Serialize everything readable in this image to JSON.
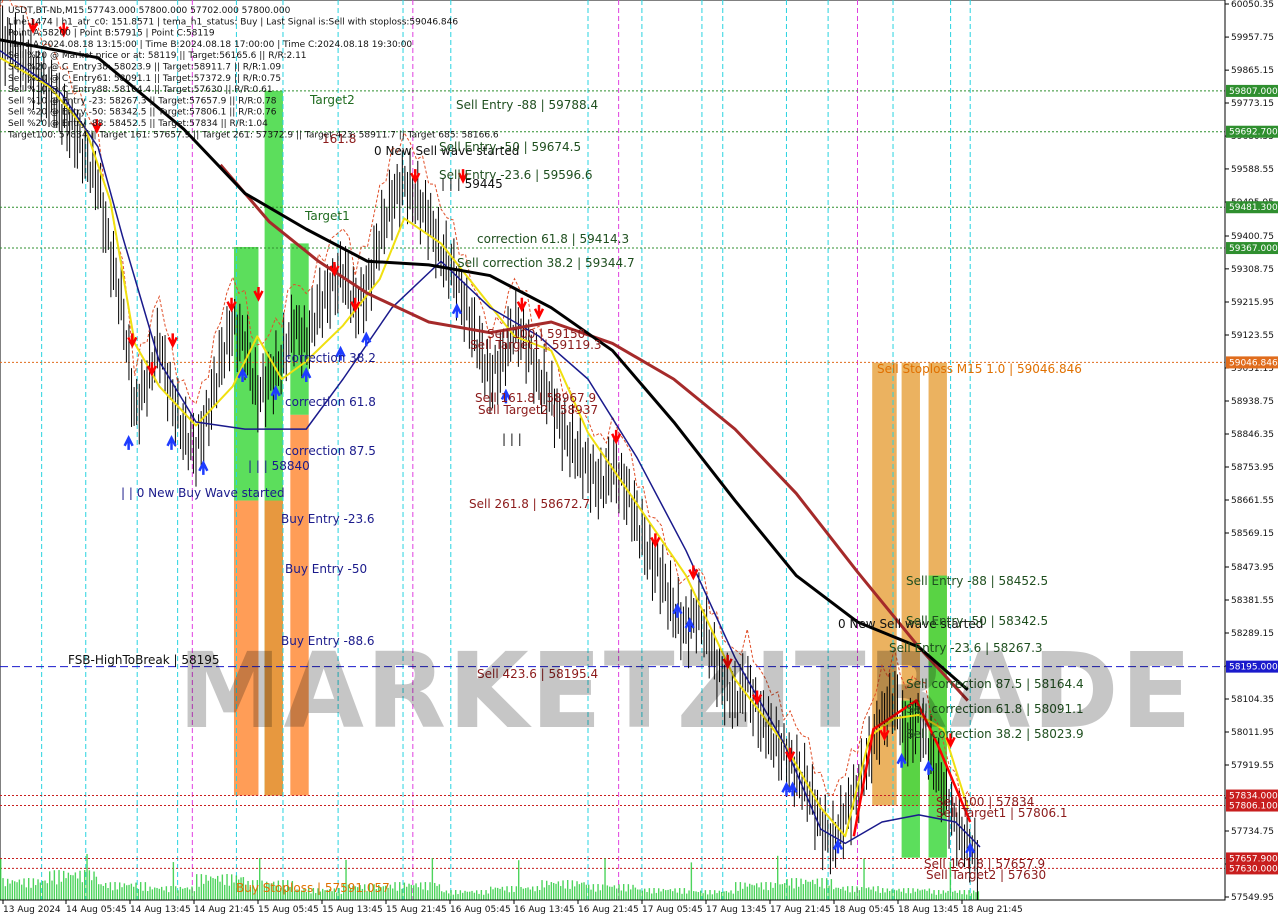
{
  "info_lines": [
    "USDT,BT-Nb,M15  57743.000 57800.000 57702.000 57800.000",
    "Line:1474 | h1_atr_c0: 151.8571 | tema_h1_status: Buy | Last Signal is:Sell with stoploss:59046.846",
    "Point A:58200 | Point B:57915 | Point C:58119",
    "Time A:2024.08.18 13:15:00 | Time B:2024.08.18 17:00:00 | Time C:2024.08.18 19:30:00",
    "Sell %20 @ Market price or at: 58119 || Target:56165.6 || R/R:2.11",
    "Sell %20 @ C_Entry38: 58023.9 || Target:58911.7 || R/R:1.09",
    "Sell %10 @ C_Entry61: 58091.1 || Target:57372.9 || R/R:0.75",
    "Sell %10 @ C_Entry88: 58164.4 || Target:57630 || R/R:0.61",
    "Sell %10 @ Entry -23: 58267.3 || Target:57657.9 || R/R:0.78",
    "Sell %20 @ Entry -50: 58342.5 || Target:57806.1 || R/R:0.76",
    "Sell %20 @ Entry -88: 58452.5 || Target:57834 || R/R:1.04",
    "Target100: 57834 || Target 161: 57657.9 || Target 261: 57372.9 || Target 423: 58911.7 || Target 685: 58166.6"
  ],
  "annotations": [
    {
      "text": "Target2",
      "color": "#1f6b1f"
    },
    {
      "text": "Target1",
      "color": "#1f6b1f"
    },
    {
      "text": "161.8",
      "color": "#8b1a1a"
    },
    {
      "text": "0 New Sell wave started",
      "color": "#111111"
    },
    {
      "text": "Sell Entry -88 | 59788.4",
      "color": "#1f4f1f"
    },
    {
      "text": "Sell Entry -50 | 59674.5",
      "color": "#1f4f1f"
    },
    {
      "text": "Sell Entry -23.6 | 59596.6",
      "color": "#1f4f1f"
    },
    {
      "text": "| | | 59445",
      "color": "#111111"
    },
    {
      "text": "correction 61.8 | 59414.3",
      "color": "#1f4f1f"
    },
    {
      "text": "Sell correction 38.2 | 59344.7",
      "color": "#1f4f1f"
    },
    {
      "text": "Sell 100 | 59150",
      "color": "#8b1a1a"
    },
    {
      "text": "Sell Target1 | 59119.3",
      "color": "#8b1a1a"
    },
    {
      "text": "Sell 161.8 | 58967.9",
      "color": "#8b1a1a"
    },
    {
      "text": "Sell Target2 | 58937",
      "color": "#8b1a1a"
    },
    {
      "text": "| | |",
      "color": "#111111"
    },
    {
      "text": "Sell  261.8 | 58672.7",
      "color": "#8b1a1a"
    },
    {
      "text": "Sell  423.6 | 58195.4",
      "color": "#8b1a1a"
    },
    {
      "text": "correction 38.2",
      "color": "#1a1a8b"
    },
    {
      "text": "correction 61.8",
      "color": "#1a1a8b"
    },
    {
      "text": "correction 87.5",
      "color": "#1a1a8b"
    },
    {
      "text": "| | | 58840",
      "color": "#1a1a8b"
    },
    {
      "text": "| | 0 New Buy Wave started",
      "color": "#1a1a8b"
    },
    {
      "text": "Buy Entry -23.6",
      "color": "#1a1a8b"
    },
    {
      "text": "Buy Entry -50",
      "color": "#1a1a8b"
    },
    {
      "text": "Buy Entry -88.6",
      "color": "#1a1a8b"
    },
    {
      "text": "Buy Stoploss | 57591.057",
      "color": "#e07000"
    },
    {
      "text": "Sell Stoploss M15 1.0 | 59046.846",
      "color": "#e07000"
    },
    {
      "text": "FSB-HighToBreak | 58195",
      "color": "#111111"
    },
    {
      "text": "Sell Entry -88 | 58452.5",
      "color": "#1f4f1f"
    },
    {
      "text": "0 New Sell wave started",
      "color": "#111111"
    },
    {
      "text": "Sell Entry -50 | 58342.5",
      "color": "#1f4f1f"
    },
    {
      "text": "Sell Entry -23.6 | 58267.3",
      "color": "#1f4f1f"
    },
    {
      "text": "Sell correction 87.5 | 58164.4",
      "color": "#1f4f1f"
    },
    {
      "text": "Sell correction 61.8 | 58091.1",
      "color": "#1f4f1f"
    },
    {
      "text": "Sell correction 38.2 | 58023.9",
      "color": "#1f4f1f"
    },
    {
      "text": "Sell 100 | 57834",
      "color": "#8b1a1a"
    },
    {
      "text": "Sell Target1 | 57806.1",
      "color": "#8b1a1a"
    },
    {
      "text": "Sell 161.8 | 57657.9",
      "color": "#8b1a1a"
    },
    {
      "text": "Sell Target2 | 57630",
      "color": "#8b1a1a"
    }
  ],
  "watermark_text": "MARKETZITRADE",
  "chart_data": {
    "type": "candlestick",
    "symbol": "USDT,BT-Nb",
    "timeframe": "M15",
    "ylim": [
      57549.95,
      60050.35
    ],
    "y_ticks": [
      60050.35,
      59957.75,
      59865.15,
      59773.15,
      59680.55,
      59588.55,
      59495.95,
      59400.75,
      59308.75,
      59215.95,
      59123.55,
      59031.15,
      58938.75,
      58846.35,
      58753.95,
      58661.55,
      58569.15,
      58473.95,
      58381.55,
      58289.15,
      58196.75,
      58104.35,
      58011.95,
      57919.55,
      57827.15,
      57734.75,
      57642.35,
      57549.95
    ],
    "x_labels": [
      "13 Aug 2024",
      "14 Aug 05:45",
      "14 Aug 13:45",
      "14 Aug 21:45",
      "15 Aug 05:45",
      "15 Aug 13:45",
      "15 Aug 21:45",
      "16 Aug 05:45",
      "16 Aug 13:45",
      "16 Aug 21:45",
      "17 Aug 05:45",
      "17 Aug 13:45",
      "17 Aug 21:45",
      "18 Aug 05:45",
      "18 Aug 13:45",
      "18 Aug 21:45"
    ],
    "price_levels": [
      {
        "value": 59807.0,
        "label": "59807.000",
        "color": "#2f8f2f",
        "style": "dotted"
      },
      {
        "value": 59692.7,
        "label": "59692.700",
        "color": "#2f8f2f",
        "style": "dotted"
      },
      {
        "value": 59481.3,
        "label": "59481.300",
        "color": "#2f8f2f",
        "style": "dotted"
      },
      {
        "value": 59367.0,
        "label": "59367.000",
        "color": "#2f8f2f",
        "style": "dotted"
      },
      {
        "value": 59046.846,
        "label": "59046.846",
        "color": "#e06c1c",
        "style": "dotted"
      },
      {
        "value": 58195.0,
        "label": "58195.000",
        "color": "#1a1acc",
        "style": "dashed"
      },
      {
        "value": 57834.0,
        "label": "57834.000",
        "color": "#c81e1e",
        "style": "dotted"
      },
      {
        "value": 57806.1,
        "label": "57806.100",
        "color": "#c81e1e",
        "style": "dotted"
      },
      {
        "value": 57657.9,
        "label": "57657.900",
        "color": "#c81e1e",
        "style": "dotted"
      },
      {
        "value": 57630.0,
        "label": "57630.000",
        "color": "#c81e1e",
        "style": "dotted"
      }
    ],
    "zones": [
      {
        "x_frac": [
          0.191,
          0.211
        ],
        "price": [
          58660,
          59370
        ],
        "color": "#3fd83f"
      },
      {
        "x_frac": [
          0.191,
          0.211
        ],
        "price": [
          57834,
          58660
        ],
        "color": "#ff8c3a"
      },
      {
        "x_frac": [
          0.216,
          0.231
        ],
        "price": [
          57834,
          59807
        ],
        "color": "#3fd83f"
      },
      {
        "x_frac": [
          0.216,
          0.231
        ],
        "price": [
          57834,
          58660
        ],
        "color": "#ff8c3a"
      },
      {
        "x_frac": [
          0.237,
          0.252
        ],
        "price": [
          58900,
          59380
        ],
        "color": "#3fd83f"
      },
      {
        "x_frac": [
          0.237,
          0.252
        ],
        "price": [
          57834,
          58900
        ],
        "color": "#ff8c3a"
      },
      {
        "x_frac": [
          0.712,
          0.732
        ],
        "price": [
          57806,
          59046
        ],
        "color": "#e8a444"
      },
      {
        "x_frac": [
          0.736,
          0.751
        ],
        "price": [
          57806,
          59046
        ],
        "color": "#e8a444"
      },
      {
        "x_frac": [
          0.736,
          0.751
        ],
        "price": [
          57660,
          58100
        ],
        "color": "#3fd83f"
      },
      {
        "x_frac": [
          0.758,
          0.773
        ],
        "price": [
          57806,
          59046
        ],
        "color": "#e8a444"
      },
      {
        "x_frac": [
          0.758,
          0.773
        ],
        "price": [
          57660,
          58450
        ],
        "color": "#3fd83f"
      }
    ],
    "vlines_cyan_frac": [
      0.034,
      0.07,
      0.112,
      0.145,
      0.193,
      0.231,
      0.276,
      0.329,
      0.368,
      0.48,
      0.524,
      0.573,
      0.59,
      0.642,
      0.676,
      0.729,
      0.776,
      0.792
    ],
    "vlines_magenta_frac": [
      0.157,
      0.337,
      0.505,
      0.7
    ],
    "close_path": [
      [
        0.0,
        59950
      ],
      [
        0.02,
        59900
      ],
      [
        0.04,
        59800
      ],
      [
        0.06,
        59700
      ],
      [
        0.08,
        59550
      ],
      [
        0.09,
        59350
      ],
      [
        0.1,
        59200
      ],
      [
        0.11,
        58900
      ],
      [
        0.12,
        59000
      ],
      [
        0.13,
        59100
      ],
      [
        0.14,
        58950
      ],
      [
        0.15,
        58850
      ],
      [
        0.16,
        58800
      ],
      [
        0.17,
        58900
      ],
      [
        0.18,
        59050
      ],
      [
        0.19,
        59150
      ],
      [
        0.2,
        59100
      ],
      [
        0.21,
        58950
      ],
      [
        0.22,
        59000
      ],
      [
        0.23,
        59050
      ],
      [
        0.24,
        59150
      ],
      [
        0.25,
        59100
      ],
      [
        0.26,
        59200
      ],
      [
        0.27,
        59250
      ],
      [
        0.28,
        59300
      ],
      [
        0.29,
        59200
      ],
      [
        0.3,
        59250
      ],
      [
        0.31,
        59400
      ],
      [
        0.32,
        59500
      ],
      [
        0.33,
        59550
      ],
      [
        0.34,
        59500
      ],
      [
        0.35,
        59450
      ],
      [
        0.36,
        59350
      ],
      [
        0.37,
        59300
      ],
      [
        0.38,
        59200
      ],
      [
        0.39,
        59100
      ],
      [
        0.4,
        59000
      ],
      [
        0.41,
        59050
      ],
      [
        0.42,
        59150
      ],
      [
        0.43,
        59100
      ],
      [
        0.44,
        59000
      ],
      [
        0.45,
        58950
      ],
      [
        0.46,
        58850
      ],
      [
        0.47,
        58800
      ],
      [
        0.48,
        58750
      ],
      [
        0.49,
        58700
      ],
      [
        0.5,
        58750
      ],
      [
        0.51,
        58700
      ],
      [
        0.52,
        58600
      ],
      [
        0.53,
        58500
      ],
      [
        0.54,
        58450
      ],
      [
        0.55,
        58350
      ],
      [
        0.56,
        58300
      ],
      [
        0.57,
        58350
      ],
      [
        0.58,
        58250
      ],
      [
        0.59,
        58150
      ],
      [
        0.6,
        58100
      ],
      [
        0.61,
        58150
      ],
      [
        0.62,
        58050
      ],
      [
        0.63,
        58000
      ],
      [
        0.64,
        57950
      ],
      [
        0.65,
        57900
      ],
      [
        0.66,
        57850
      ],
      [
        0.67,
        57750
      ],
      [
        0.68,
        57700
      ],
      [
        0.69,
        57780
      ],
      [
        0.7,
        57850
      ],
      [
        0.71,
        57950
      ],
      [
        0.72,
        58050
      ],
      [
        0.73,
        58100
      ],
      [
        0.74,
        58000
      ],
      [
        0.75,
        58050
      ],
      [
        0.76,
        57950
      ],
      [
        0.77,
        57850
      ],
      [
        0.78,
        57750
      ],
      [
        0.79,
        57700
      ],
      [
        0.8,
        57650
      ]
    ],
    "ma_black": [
      [
        0.0,
        59950
      ],
      [
        0.08,
        59900
      ],
      [
        0.15,
        59700
      ],
      [
        0.2,
        59520
      ],
      [
        0.25,
        59420
      ],
      [
        0.3,
        59330
      ],
      [
        0.35,
        59320
      ],
      [
        0.4,
        59290
      ],
      [
        0.45,
        59200
      ],
      [
        0.5,
        59080
      ],
      [
        0.55,
        58880
      ],
      [
        0.6,
        58660
      ],
      [
        0.65,
        58450
      ],
      [
        0.7,
        58320
      ],
      [
        0.75,
        58250
      ],
      [
        0.79,
        58130
      ]
    ],
    "ma_darkred": [
      [
        0.18,
        59600
      ],
      [
        0.22,
        59440
      ],
      [
        0.26,
        59330
      ],
      [
        0.3,
        59240
      ],
      [
        0.35,
        59160
      ],
      [
        0.4,
        59130
      ],
      [
        0.45,
        59160
      ],
      [
        0.5,
        59100
      ],
      [
        0.55,
        59000
      ],
      [
        0.6,
        58860
      ],
      [
        0.65,
        58680
      ],
      [
        0.7,
        58460
      ],
      [
        0.75,
        58250
      ],
      [
        0.79,
        58100
      ]
    ],
    "ma_navy": [
      [
        0.0,
        59920
      ],
      [
        0.05,
        59800
      ],
      [
        0.08,
        59650
      ],
      [
        0.1,
        59400
      ],
      [
        0.13,
        59050
      ],
      [
        0.16,
        58880
      ],
      [
        0.2,
        58860
      ],
      [
        0.25,
        58860
      ],
      [
        0.28,
        59000
      ],
      [
        0.32,
        59200
      ],
      [
        0.36,
        59330
      ],
      [
        0.4,
        59200
      ],
      [
        0.44,
        59120
      ],
      [
        0.48,
        59000
      ],
      [
        0.52,
        58780
      ],
      [
        0.56,
        58520
      ],
      [
        0.6,
        58220
      ],
      [
        0.64,
        57980
      ],
      [
        0.67,
        57740
      ],
      [
        0.69,
        57700
      ],
      [
        0.72,
        57760
      ],
      [
        0.75,
        57780
      ],
      [
        0.78,
        57760
      ],
      [
        0.8,
        57690
      ]
    ],
    "ma_yellow": [
      [
        0.0,
        59900
      ],
      [
        0.04,
        59820
      ],
      [
        0.07,
        59700
      ],
      [
        0.09,
        59500
      ],
      [
        0.11,
        59100
      ],
      [
        0.13,
        58980
      ],
      [
        0.16,
        58870
      ],
      [
        0.19,
        58980
      ],
      [
        0.21,
        59120
      ],
      [
        0.23,
        59000
      ],
      [
        0.25,
        59050
      ],
      [
        0.28,
        59150
      ],
      [
        0.31,
        59280
      ],
      [
        0.33,
        59450
      ],
      [
        0.36,
        59380
      ],
      [
        0.39,
        59250
      ],
      [
        0.42,
        59120
      ],
      [
        0.45,
        59080
      ],
      [
        0.48,
        58850
      ],
      [
        0.52,
        58650
      ],
      [
        0.56,
        58450
      ],
      [
        0.6,
        58160
      ],
      [
        0.64,
        57980
      ],
      [
        0.67,
        57800
      ],
      [
        0.69,
        57720
      ],
      [
        0.71,
        58000
      ],
      [
        0.73,
        58050
      ],
      [
        0.75,
        58060
      ],
      [
        0.77,
        58020
      ],
      [
        0.79,
        57800
      ]
    ],
    "red_leg": [
      [
        0.697,
        57720
      ],
      [
        0.713,
        58020
      ],
      [
        0.748,
        58100
      ],
      [
        0.765,
        57980
      ],
      [
        0.792,
        57760
      ]
    ],
    "up_arrows_frac": [
      [
        0.105,
        58830
      ],
      [
        0.14,
        58830
      ],
      [
        0.166,
        58760
      ],
      [
        0.198,
        59020
      ],
      [
        0.225,
        58970
      ],
      [
        0.25,
        59020
      ],
      [
        0.278,
        59080
      ],
      [
        0.299,
        59120
      ],
      [
        0.373,
        59200
      ],
      [
        0.413,
        58960
      ],
      [
        0.553,
        58360
      ],
      [
        0.563,
        58320
      ],
      [
        0.642,
        57860
      ],
      [
        0.647,
        57860
      ],
      [
        0.684,
        57700
      ],
      [
        0.736,
        57940
      ],
      [
        0.758,
        57920
      ],
      [
        0.792,
        57690
      ]
    ],
    "down_arrows_frac": [
      [
        0.027,
        59980
      ],
      [
        0.052,
        59970
      ],
      [
        0.079,
        59700
      ],
      [
        0.108,
        59100
      ],
      [
        0.124,
        59020
      ],
      [
        0.141,
        59100
      ],
      [
        0.189,
        59200
      ],
      [
        0.211,
        59230
      ],
      [
        0.273,
        59300
      ],
      [
        0.29,
        59200
      ],
      [
        0.339,
        59560
      ],
      [
        0.378,
        59560
      ],
      [
        0.426,
        59200
      ],
      [
        0.44,
        59180
      ],
      [
        0.503,
        58830
      ],
      [
        0.535,
        58540
      ],
      [
        0.566,
        58450
      ],
      [
        0.594,
        58200
      ],
      [
        0.618,
        58100
      ],
      [
        0.645,
        57940
      ],
      [
        0.722,
        58000
      ],
      [
        0.776,
        57980
      ]
    ],
    "volume_profile": [
      22,
      30,
      18,
      14,
      26,
      20,
      12,
      16,
      18,
      10,
      14,
      20,
      16,
      12,
      10,
      18,
      22,
      14,
      12,
      10
    ]
  }
}
